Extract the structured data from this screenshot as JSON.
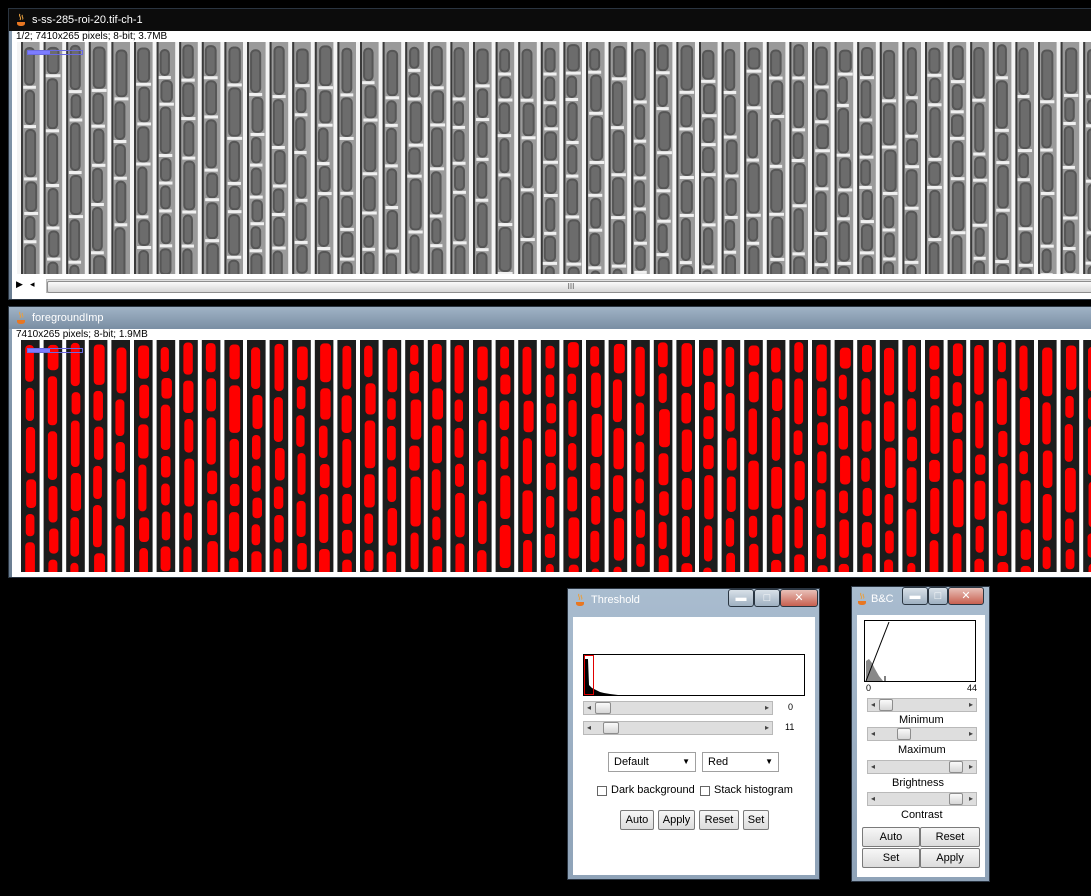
{
  "window1": {
    "title": "s-ss-285-roi-20.tif-ch-1",
    "info": "1/2; 7410x265 pixels; 8-bit; 3.7MB",
    "scroll_grip": "III"
  },
  "window2": {
    "title": "foregroundImp",
    "info": "7410x265 pixels; 8-bit; 1.9MB"
  },
  "threshold": {
    "title": "Threshold",
    "slider1_value": "0",
    "slider2_value": "11",
    "method": "Default",
    "display": "Red",
    "dark_background": "Dark background",
    "stack_histogram": "Stack histogram",
    "buttons": {
      "auto": "Auto",
      "apply": "Apply",
      "reset": "Reset",
      "set": "Set"
    }
  },
  "bc": {
    "title": "B&C",
    "min_label": "0",
    "max_label": "44",
    "minimum": "Minimum",
    "maximum": "Maximum",
    "brightness": "Brightness",
    "contrast": "Contrast",
    "buttons": {
      "auto": "Auto",
      "reset": "Reset",
      "set": "Set",
      "apply": "Apply"
    }
  },
  "colors": {
    "mask": "#ff0000",
    "channel_bg": "#1c1c1c",
    "divider": "#ffffff"
  },
  "icons": {
    "java_coffee_cup": "java-icon",
    "minimize": "minimize-icon",
    "maximize": "maximize-icon",
    "close": "close-icon"
  }
}
